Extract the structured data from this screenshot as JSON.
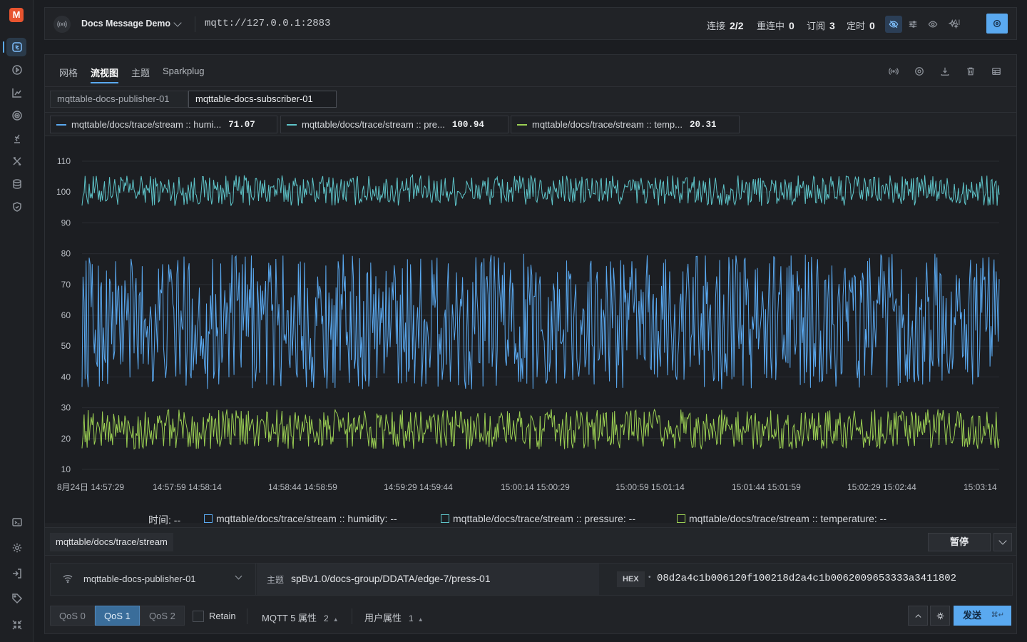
{
  "app": {
    "logo_text": "M",
    "nav": [
      {
        "name": "nav-connections-icon",
        "active": true
      },
      {
        "name": "nav-play-icon"
      },
      {
        "name": "nav-chart-icon"
      },
      {
        "name": "nav-target-icon"
      },
      {
        "name": "nav-script-icon"
      },
      {
        "name": "nav-tools-icon"
      },
      {
        "name": "nav-database-icon"
      },
      {
        "name": "nav-shield-icon"
      }
    ],
    "nav_bottom": [
      {
        "name": "nav-terminal-icon"
      },
      {
        "name": "nav-settings-icon"
      },
      {
        "name": "nav-login-icon"
      },
      {
        "name": "nav-tag-icon"
      },
      {
        "name": "nav-collapse-icon"
      }
    ]
  },
  "topbar": {
    "connection_name": "Docs Message Demo",
    "url": "mqtt://127.0.0.1:2883",
    "stats": [
      {
        "label": "连接",
        "value": "2/2"
      },
      {
        "label": "重连中",
        "value": "0"
      },
      {
        "label": "订阅",
        "value": "3"
      },
      {
        "label": "定时",
        "value": "0"
      }
    ],
    "ai_label": "AI"
  },
  "tabs": {
    "items": [
      "网格",
      "流视图",
      "主题",
      "Sparkplug"
    ],
    "active_index": 1
  },
  "subtabs": {
    "items": [
      "mqttable-docs-publisher-01",
      "mqttable-docs-subscriber-01"
    ],
    "active_index": 1
  },
  "series_chips": [
    {
      "label": "mqttable/docs/trace/stream :: humi...",
      "value": "71.07",
      "color": "#5aa9f0"
    },
    {
      "label": "mqttable/docs/trace/stream :: pre...",
      "value": "100.94",
      "color": "#5ec4c9"
    },
    {
      "label": "mqttable/docs/trace/stream :: temp...",
      "value": "20.31",
      "color": "#9bcf53"
    }
  ],
  "chart_data": {
    "type": "line",
    "ylim": [
      10,
      110
    ],
    "yticks": [
      "110",
      "100",
      "90",
      "80",
      "70",
      "60",
      "50",
      "40",
      "30",
      "20",
      "10"
    ],
    "xticks": [
      "8月24日 14:57:29",
      "14:57:59 14:58:14",
      "14:58:44 14:58:59",
      "14:59:29 14:59:44",
      "15:00:14 15:00:29",
      "15:00:59 15:01:14",
      "15:01:44 15:01:59",
      "15:02:29 15:02:44",
      "15:03:14"
    ],
    "series": [
      {
        "name": "mqttable/docs/trace/stream :: pressure",
        "color": "#5ec4c9",
        "center": 100.5,
        "amplitude": 5,
        "points": 900
      },
      {
        "name": "mqttable/docs/trace/stream :: humidity",
        "color": "#5aa9f0",
        "center": 58,
        "amplitude": 22,
        "points": 900
      },
      {
        "name": "mqttable/docs/trace/stream :: temperature",
        "color": "#9bcf53",
        "center": 23,
        "amplitude": 6.5,
        "points": 900
      }
    ]
  },
  "legend": {
    "time_label": "时间:  --",
    "items": [
      {
        "text": "mqttable/docs/trace/stream :: humidity:  --",
        "color": "#5aa9f0"
      },
      {
        "text": "mqttable/docs/trace/stream :: pressure:  --",
        "color": "#5ec4c9"
      },
      {
        "text": "mqttable/docs/trace/stream :: temperature:  --",
        "color": "#9bcf53"
      }
    ]
  },
  "topicbar": {
    "topic": "mqttable/docs/trace/stream",
    "pause_label": "暂停"
  },
  "publish": {
    "client": "mqttable-docs-publisher-01",
    "topic_label": "主题",
    "topic": "spBv1.0/docs-group/DDATA/edge-7/press-01",
    "format": "HEX",
    "payload": "08d2a4c1b006120f100218d2a4c1b0062009653333a3411802",
    "qos": [
      "QoS 0",
      "QoS 1",
      "QoS 2"
    ],
    "qos_active": 1,
    "retain_label": "Retain",
    "mqtt5_label": "MQTT 5 属性",
    "mqtt5_count": "2",
    "user_props_label": "用户属性",
    "user_props_count": "1",
    "send_label": "发送",
    "send_shortcut": "⌘↵"
  }
}
